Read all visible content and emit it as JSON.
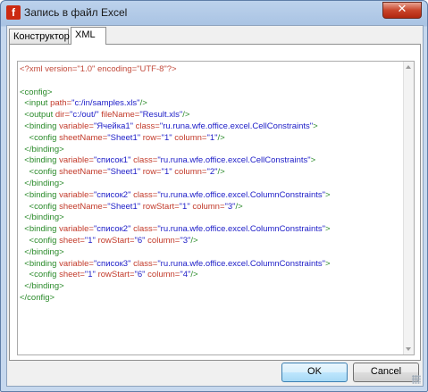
{
  "window": {
    "title": "Запись в файл Excel",
    "app_icon": "f-logo-icon",
    "close_glyph": "✕",
    "accent": "#c9452b"
  },
  "tabs": [
    {
      "label": "Конструктор",
      "active": false
    },
    {
      "label": "XML",
      "active": true
    }
  ],
  "xml_lines": [
    [
      {
        "t": "<?xml version=\"1.0\" encoding=\"UTF-8\"?>",
        "c": "pi"
      }
    ],
    [],
    [
      {
        "t": "<config>",
        "c": "tag"
      }
    ],
    [
      {
        "t": "  <input ",
        "c": "tag"
      },
      {
        "t": "path=",
        "c": "attr"
      },
      {
        "t": "\"c:/in/samples.xls\"",
        "c": "val"
      },
      {
        "t": "/>",
        "c": "tag"
      }
    ],
    [
      {
        "t": "  <output ",
        "c": "tag"
      },
      {
        "t": "dir=",
        "c": "attr"
      },
      {
        "t": "\"c:/out/\"",
        "c": "val"
      },
      {
        "t": " fileName=",
        "c": "attr"
      },
      {
        "t": "\"Result.xls\"",
        "c": "val"
      },
      {
        "t": "/>",
        "c": "tag"
      }
    ],
    [
      {
        "t": "  <binding ",
        "c": "tag"
      },
      {
        "t": "variable=",
        "c": "attr"
      },
      {
        "t": "\"Ячейка1\"",
        "c": "val"
      },
      {
        "t": " class=",
        "c": "attr"
      },
      {
        "t": "\"ru.runa.wfe.office.excel.CellConstraints\"",
        "c": "val"
      },
      {
        "t": ">",
        "c": "tag"
      }
    ],
    [
      {
        "t": "    <config ",
        "c": "tag"
      },
      {
        "t": "sheetName=",
        "c": "attr"
      },
      {
        "t": "\"Sheet1\"",
        "c": "val"
      },
      {
        "t": " row=",
        "c": "attr"
      },
      {
        "t": "\"1\"",
        "c": "val"
      },
      {
        "t": " column=",
        "c": "attr"
      },
      {
        "t": "\"1\"",
        "c": "val"
      },
      {
        "t": "/>",
        "c": "tag"
      }
    ],
    [
      {
        "t": "  </binding>",
        "c": "tag"
      }
    ],
    [
      {
        "t": "  <binding ",
        "c": "tag"
      },
      {
        "t": "variable=",
        "c": "attr"
      },
      {
        "t": "\"список1\"",
        "c": "val"
      },
      {
        "t": " class=",
        "c": "attr"
      },
      {
        "t": "\"ru.runa.wfe.office.excel.CellConstraints\"",
        "c": "val"
      },
      {
        "t": ">",
        "c": "tag"
      }
    ],
    [
      {
        "t": "    <config ",
        "c": "tag"
      },
      {
        "t": "sheetName=",
        "c": "attr"
      },
      {
        "t": "\"Sheet1\"",
        "c": "val"
      },
      {
        "t": " row=",
        "c": "attr"
      },
      {
        "t": "\"1\"",
        "c": "val"
      },
      {
        "t": " column=",
        "c": "attr"
      },
      {
        "t": "\"2\"",
        "c": "val"
      },
      {
        "t": "/>",
        "c": "tag"
      }
    ],
    [
      {
        "t": "  </binding>",
        "c": "tag"
      }
    ],
    [
      {
        "t": "  <binding ",
        "c": "tag"
      },
      {
        "t": "variable=",
        "c": "attr"
      },
      {
        "t": "\"список2\"",
        "c": "val"
      },
      {
        "t": " class=",
        "c": "attr"
      },
      {
        "t": "\"ru.runa.wfe.office.excel.ColumnConstraints\"",
        "c": "val"
      },
      {
        "t": ">",
        "c": "tag"
      }
    ],
    [
      {
        "t": "    <config ",
        "c": "tag"
      },
      {
        "t": "sheetName=",
        "c": "attr"
      },
      {
        "t": "\"Sheet1\"",
        "c": "val"
      },
      {
        "t": " rowStart=",
        "c": "attr"
      },
      {
        "t": "\"1\"",
        "c": "val"
      },
      {
        "t": " column=",
        "c": "attr"
      },
      {
        "t": "\"3\"",
        "c": "val"
      },
      {
        "t": "/>",
        "c": "tag"
      }
    ],
    [
      {
        "t": "  </binding>",
        "c": "tag"
      }
    ],
    [
      {
        "t": "  <binding ",
        "c": "tag"
      },
      {
        "t": "variable=",
        "c": "attr"
      },
      {
        "t": "\"список2\"",
        "c": "val"
      },
      {
        "t": " class=",
        "c": "attr"
      },
      {
        "t": "\"ru.runa.wfe.office.excel.ColumnConstraints\"",
        "c": "val"
      },
      {
        "t": ">",
        "c": "tag"
      }
    ],
    [
      {
        "t": "    <config ",
        "c": "tag"
      },
      {
        "t": "sheet=",
        "c": "attr"
      },
      {
        "t": "\"1\"",
        "c": "val"
      },
      {
        "t": " rowStart=",
        "c": "attr"
      },
      {
        "t": "\"6\"",
        "c": "val"
      },
      {
        "t": " column=",
        "c": "attr"
      },
      {
        "t": "\"3\"",
        "c": "val"
      },
      {
        "t": "/>",
        "c": "tag"
      }
    ],
    [
      {
        "t": "  </binding>",
        "c": "tag"
      }
    ],
    [
      {
        "t": "  <binding ",
        "c": "tag"
      },
      {
        "t": "variable=",
        "c": "attr"
      },
      {
        "t": "\"список3\"",
        "c": "val"
      },
      {
        "t": " class=",
        "c": "attr"
      },
      {
        "t": "\"ru.runa.wfe.office.excel.ColumnConstraints\"",
        "c": "val"
      },
      {
        "t": ">",
        "c": "tag"
      }
    ],
    [
      {
        "t": "    <config ",
        "c": "tag"
      },
      {
        "t": "sheet=",
        "c": "attr"
      },
      {
        "t": "\"1\"",
        "c": "val"
      },
      {
        "t": " rowStart=",
        "c": "attr"
      },
      {
        "t": "\"6\"",
        "c": "val"
      },
      {
        "t": " column=",
        "c": "attr"
      },
      {
        "t": "\"4\"",
        "c": "val"
      },
      {
        "t": "/>",
        "c": "tag"
      }
    ],
    [
      {
        "t": "  </binding>",
        "c": "tag"
      }
    ],
    [
      {
        "t": "</config>",
        "c": "tag"
      }
    ]
  ],
  "buttons": {
    "ok": "OK",
    "cancel": "Cancel"
  }
}
